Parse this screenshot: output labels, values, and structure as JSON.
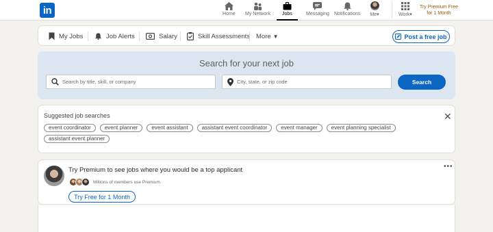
{
  "nav": {
    "logo": "in",
    "items": [
      {
        "label": "Home",
        "icon": "home-icon"
      },
      {
        "label": "My Network",
        "icon": "network-icon"
      },
      {
        "label": "Jobs",
        "icon": "briefcase-icon"
      },
      {
        "label": "Messaging",
        "icon": "messaging-icon"
      },
      {
        "label": "Notifications",
        "icon": "bell-icon"
      },
      {
        "label": "Me",
        "icon": "avatar"
      },
      {
        "label": "Work",
        "icon": "grid-icon"
      }
    ],
    "active": "Jobs",
    "premium_line1": "Try Premium Free",
    "premium_line2": "for 1 Month"
  },
  "subnav": {
    "my_jobs": "My Jobs",
    "job_alerts": "Job Alerts",
    "salary": "Salary",
    "skill_assessments": "Skill Assessments",
    "more": "More",
    "post_job": "Post a free job"
  },
  "search": {
    "title": "Search for your next job",
    "keyword_placeholder": "Search by title, skill, or company",
    "location_placeholder": "City, state, or zip code",
    "button": "Search"
  },
  "suggested": {
    "title": "Suggested job searches",
    "pills": [
      "event coordinator",
      "event planner",
      "event assistant",
      "assistant event coordinator",
      "event manager",
      "event planning specialist",
      "assistant event planner"
    ]
  },
  "premium": {
    "text": "Try Premium to see jobs where you would be a top applicant",
    "members": "Millions of members use Premium",
    "button": "Try Free for 1 Month"
  },
  "colors": {
    "brand": "#0a66c2",
    "premium": "#915907",
    "search_bg": "#dce6f1"
  }
}
